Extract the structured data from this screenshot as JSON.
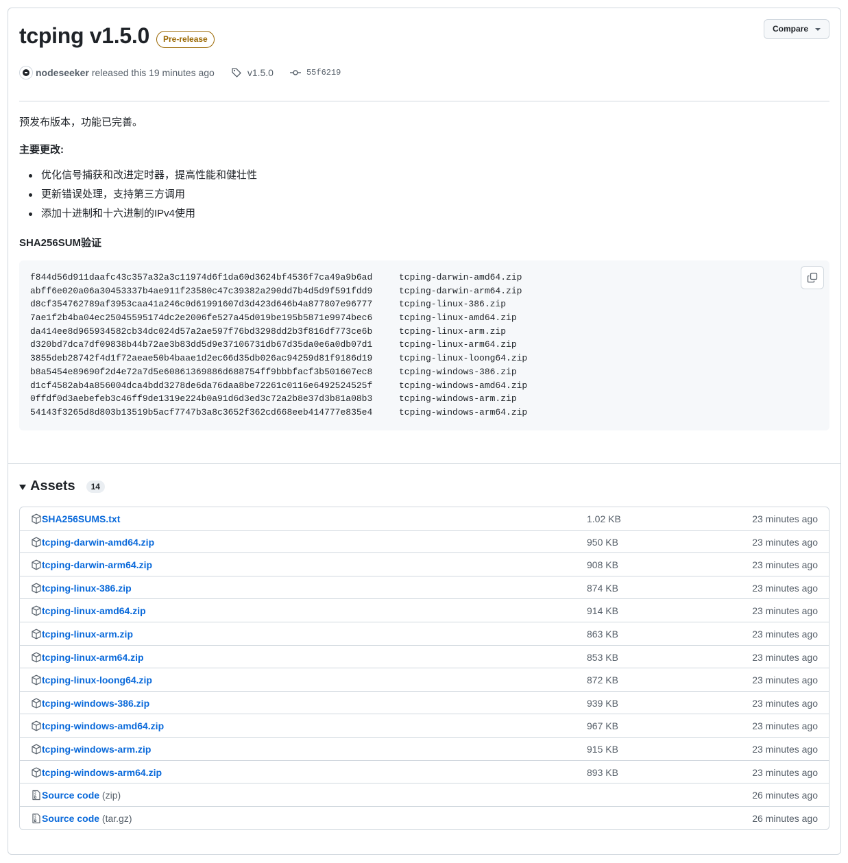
{
  "release": {
    "title": "tcping v1.5.0",
    "badge": "Pre-release",
    "compare_label": "Compare",
    "author": "nodeseeker",
    "released_text": "released this 19 minutes ago",
    "tag": "v1.5.0",
    "commit": "55f6219"
  },
  "notes": {
    "intro": "预发布版本，功能已完善。",
    "changes_heading": "主要更改:",
    "changes": [
      "优化信号捕获和改进定时器，提高性能和健壮性",
      "更新错误处理，支持第三方调用",
      "添加十进制和十六进制的IPv4使用"
    ],
    "sha_heading": "SHA256SUM验证",
    "checksums": [
      {
        "hash": "f844d56d911daafc43c357a32a3c11974d6f1da60d3624bf4536f7ca49a9b6ad",
        "file": "tcping-darwin-amd64.zip"
      },
      {
        "hash": "abff6e020a06a30453337b4ae911f23580c47c39382a290dd7b4d5d9f591fdd9",
        "file": "tcping-darwin-arm64.zip"
      },
      {
        "hash": "d8cf354762789af3953caa41a246c0d61991607d3d423d646b4a877807e96777",
        "file": "tcping-linux-386.zip"
      },
      {
        "hash": "7ae1f2b4ba04ec25045595174dc2e2006fe527a45d019be195b5871e9974bec6",
        "file": "tcping-linux-amd64.zip"
      },
      {
        "hash": "da414ee8d965934582cb34dc024d57a2ae597f76bd3298dd2b3f816df773ce6b",
        "file": "tcping-linux-arm.zip"
      },
      {
        "hash": "d320bd7dca7df09838b44b72ae3b83dd5d9e37106731db67d35da0e6a0db07d1",
        "file": "tcping-linux-arm64.zip"
      },
      {
        "hash": "3855deb28742f4d1f72aeae50b4baae1d2ec66d35db026ac94259d81f9186d19",
        "file": "tcping-linux-loong64.zip"
      },
      {
        "hash": "b8a5454e89690f2d4e72a7d5e60861369886d688754ff9bbbfacf3b501607ec8",
        "file": "tcping-windows-386.zip"
      },
      {
        "hash": "d1cf4582ab4a856004dca4bdd3278de6da76daa8be72261c0116e6492524525f",
        "file": "tcping-windows-amd64.zip"
      },
      {
        "hash": "0ffdf0d3aebefeb3c46ff9de1319e224b0a91d6d3ed3c72a2b8e37d3b81a08b3",
        "file": "tcping-windows-arm.zip"
      },
      {
        "hash": "54143f3265d8d803b13519b5acf7747b3a8c3652f362cd668eeb414777e835e4",
        "file": "tcping-windows-arm64.zip"
      }
    ]
  },
  "assets": {
    "title": "Assets",
    "count": "14",
    "items": [
      {
        "icon": "package-icon",
        "name": "SHA256SUMS.txt",
        "sub": "",
        "size": "1.02 KB",
        "time": "23 minutes ago"
      },
      {
        "icon": "package-icon",
        "name": "tcping-darwin-amd64.zip",
        "sub": "",
        "size": "950 KB",
        "time": "23 minutes ago"
      },
      {
        "icon": "package-icon",
        "name": "tcping-darwin-arm64.zip",
        "sub": "",
        "size": "908 KB",
        "time": "23 minutes ago"
      },
      {
        "icon": "package-icon",
        "name": "tcping-linux-386.zip",
        "sub": "",
        "size": "874 KB",
        "time": "23 minutes ago"
      },
      {
        "icon": "package-icon",
        "name": "tcping-linux-amd64.zip",
        "sub": "",
        "size": "914 KB",
        "time": "23 minutes ago"
      },
      {
        "icon": "package-icon",
        "name": "tcping-linux-arm.zip",
        "sub": "",
        "size": "863 KB",
        "time": "23 minutes ago"
      },
      {
        "icon": "package-icon",
        "name": "tcping-linux-arm64.zip",
        "sub": "",
        "size": "853 KB",
        "time": "23 minutes ago"
      },
      {
        "icon": "package-icon",
        "name": "tcping-linux-loong64.zip",
        "sub": "",
        "size": "872 KB",
        "time": "23 minutes ago"
      },
      {
        "icon": "package-icon",
        "name": "tcping-windows-386.zip",
        "sub": "",
        "size": "939 KB",
        "time": "23 minutes ago"
      },
      {
        "icon": "package-icon",
        "name": "tcping-windows-amd64.zip",
        "sub": "",
        "size": "967 KB",
        "time": "23 minutes ago"
      },
      {
        "icon": "package-icon",
        "name": "tcping-windows-arm.zip",
        "sub": "",
        "size": "915 KB",
        "time": "23 minutes ago"
      },
      {
        "icon": "package-icon",
        "name": "tcping-windows-arm64.zip",
        "sub": "",
        "size": "893 KB",
        "time": "23 minutes ago"
      },
      {
        "icon": "file-zip-icon",
        "name": "Source code",
        "sub": "(zip)",
        "size": "",
        "time": "26 minutes ago"
      },
      {
        "icon": "file-zip-icon",
        "name": "Source code",
        "sub": "(tar.gz)",
        "size": "",
        "time": "26 minutes ago"
      }
    ]
  },
  "colors": {
    "link": "#0969da",
    "prerelease": "#9a6700",
    "muted": "#57606a",
    "border": "#d0d7de"
  }
}
